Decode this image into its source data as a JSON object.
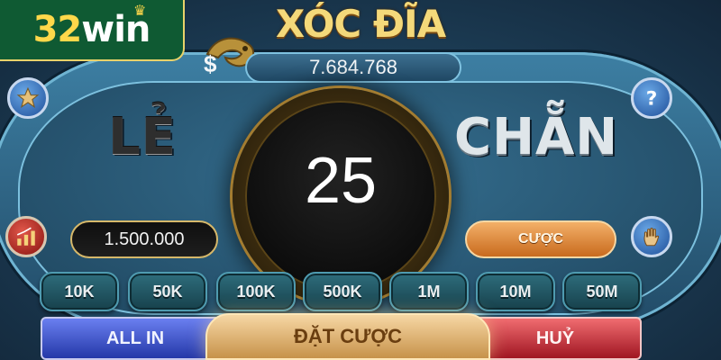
{
  "logo": {
    "number": "32",
    "word": "win"
  },
  "header": {
    "title": "XÓC ĐĨA",
    "currency_symbol": "$",
    "balance": "7.684.768"
  },
  "table": {
    "left_label": "LẺ",
    "right_label": "CHẴN",
    "timer": "25"
  },
  "bet": {
    "amount": "1.500.000",
    "place_label": "CƯỢC"
  },
  "chips": [
    "10K",
    "50K",
    "100K",
    "500K",
    "1M",
    "10M",
    "50M"
  ],
  "actions": {
    "all_in": "ALL IN",
    "confirm": "ĐẶT CƯỢC",
    "cancel": "HUỶ"
  },
  "icons": {
    "favorite": "star-icon",
    "help": "question-icon",
    "stats": "bar-chart-icon",
    "hand": "hand-icon"
  },
  "colors": {
    "table_blue": "#2d5e7c",
    "gold": "#f4d97a",
    "logo_green": "#0f5a33",
    "allin_blue": "#2438a8",
    "cancel_red": "#a01622"
  }
}
